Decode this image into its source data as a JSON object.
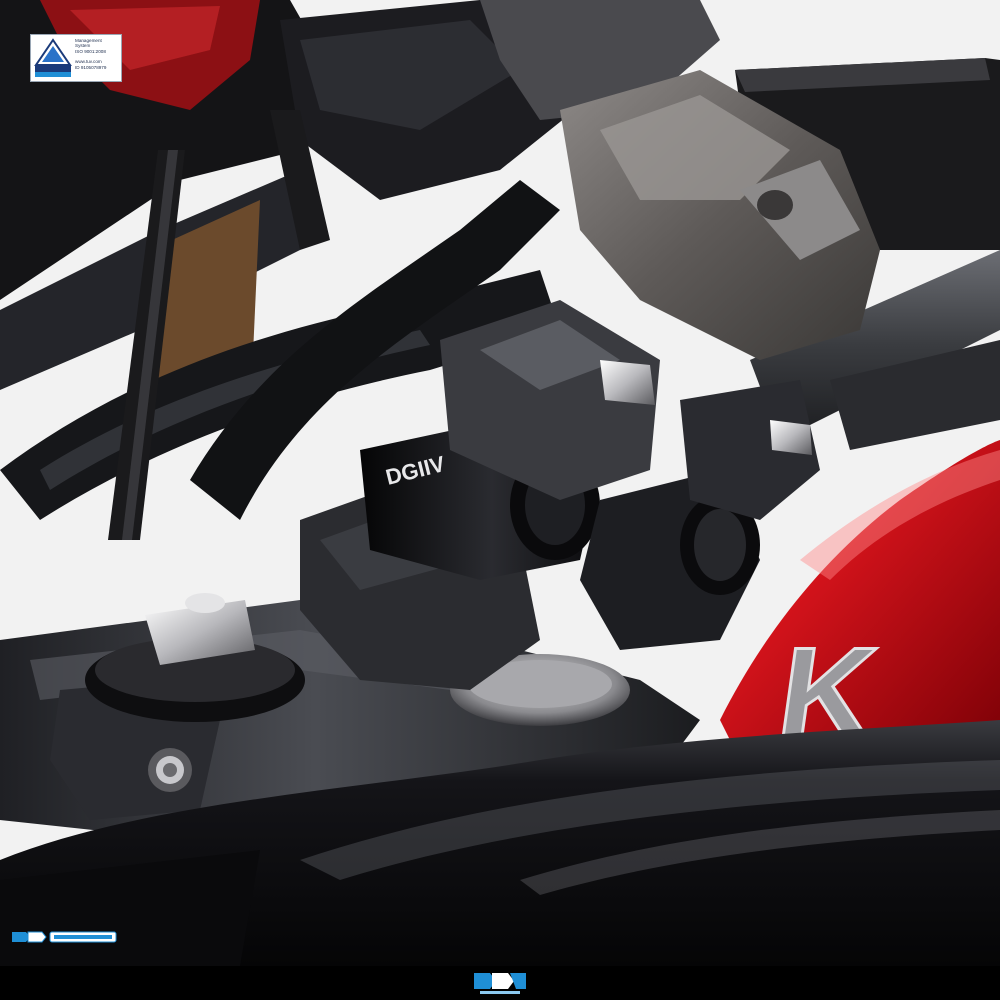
{
  "scene": {
    "description_free": true,
    "colors": {
      "background": "#f4f4f4",
      "tank_red": "#c80f16",
      "tank_black": "#0c0c0e",
      "anodized_black": "#141416",
      "clamp_gray": "#2e3034",
      "housing_gray": "#5e5c5c",
      "brand_blue": "#1f8fd6"
    }
  },
  "certification_badge": {
    "line_1": "Management",
    "line_2": "System",
    "line_3": "ISO 9001:2008",
    "line_4": "www.tuv.com",
    "line_5": "ID 9105078979",
    "icon": "tuv-rheinland-seal-icon"
  },
  "tank_lettering": "K",
  "bottom_bar_logo": "dimotiv-logo-icon",
  "corner_logo": "dimotiv-wordmark-icon"
}
